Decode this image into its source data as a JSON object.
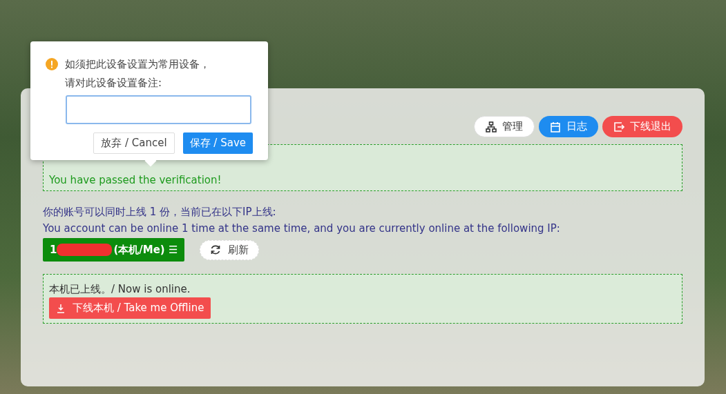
{
  "popover": {
    "message_lines": [
      "如须把此设备设置为常用设备，",
      "请对此设备设置备注:"
    ],
    "buttons": [
      {
        "label": "放弃 / Cancel",
        "kind": "plain"
      },
      {
        "label": "保存 / Save",
        "kind": "primary"
      }
    ]
  },
  "toolbar": [
    {
      "label": "管理",
      "kind": "plain"
    },
    {
      "label": "日志",
      "kind": "primary"
    },
    {
      "label": "下线退出",
      "kind": "danger"
    }
  ],
  "verification": {
    "message": "You have passed the verification!"
  },
  "online_info": {
    "line_zh": "你的账号可以同时上线 1 份，当前已在以下IP上线:",
    "line_en": "You account can be online 1 time at the same time, and you are currently online at the following IP:"
  },
  "ip_button": {
    "prefix": "1",
    "suffix": "(本机/Me)",
    "menu_glyph": "☰"
  },
  "refresh_button": {
    "label": "刷新"
  },
  "status": {
    "message": "本机已上线。/ Now is online.",
    "offline_button": "下线本机 / Take me Offline"
  }
}
